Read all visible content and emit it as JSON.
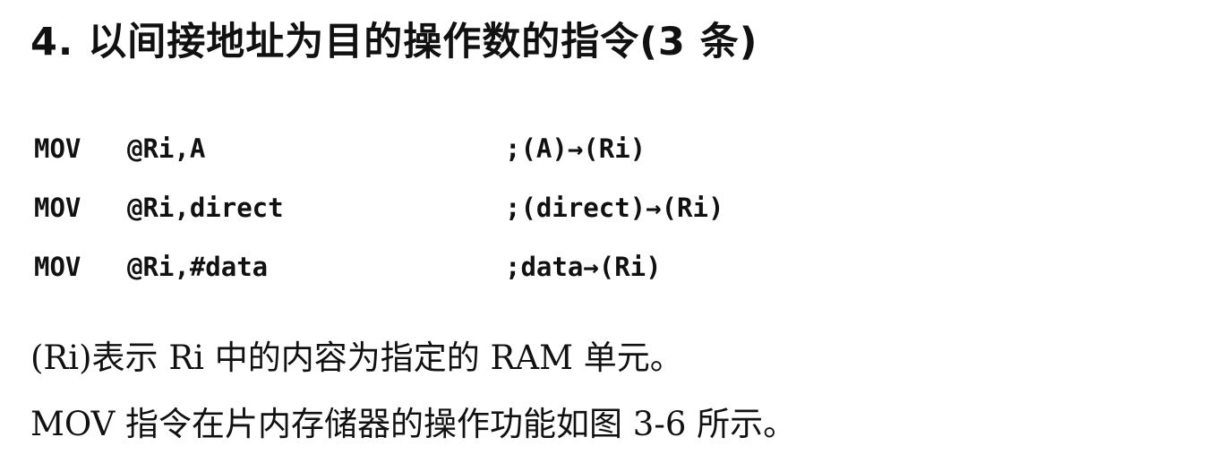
{
  "heading": "4. 以间接地址为目的操作数的指令(3 条)",
  "instructions": [
    {
      "op": "MOV",
      "operands": "@Ri,A",
      "comment": ";(A)→(Ri)"
    },
    {
      "op": "MOV",
      "operands": "@Ri,direct",
      "comment": ";(direct)→(Ri)"
    },
    {
      "op": "MOV",
      "operands": "@Ri,#data",
      "comment": ";data→(Ri)"
    }
  ],
  "paragraphs": [
    "(Ri)表示 Ri 中的内容为指定的 RAM 单元。",
    "MOV 指令在片内存储器的操作功能如图 3-6 所示。"
  ]
}
